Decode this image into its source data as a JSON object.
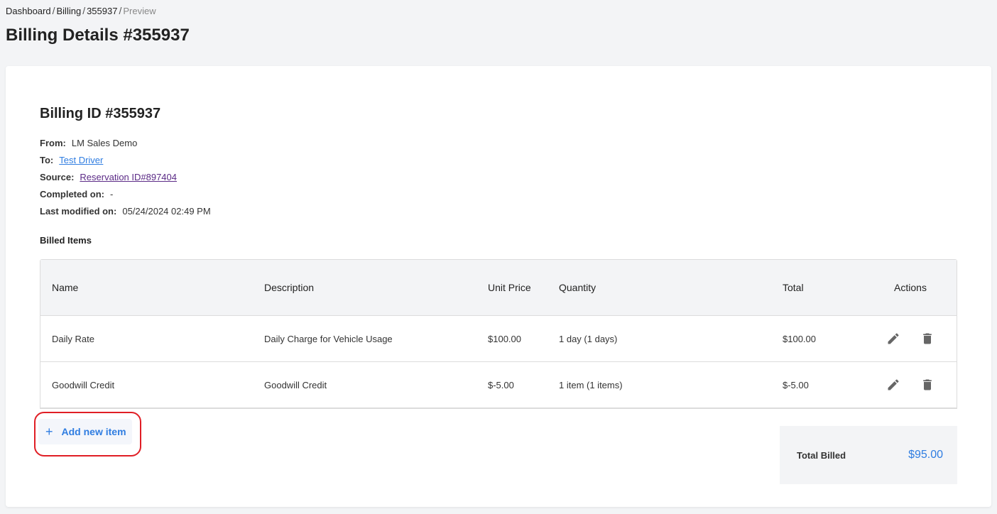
{
  "breadcrumb": {
    "items": [
      "Dashboard",
      "Billing",
      "355937",
      "Preview"
    ],
    "separator": "/"
  },
  "page": {
    "title": "Billing Details #355937"
  },
  "billing": {
    "id_title": "Billing ID #355937",
    "from_label": "From:",
    "from_value": "LM Sales Demo",
    "to_label": "To:",
    "to_value": "Test Driver",
    "source_label": "Source:",
    "source_value": "Reservation ID#897404",
    "completed_label": "Completed on:",
    "completed_value": "-",
    "modified_label": "Last modified on:",
    "modified_value": "05/24/2024 02:49 PM"
  },
  "items_section": {
    "title": "Billed Items"
  },
  "table": {
    "headers": [
      "Name",
      "Description",
      "Unit Price",
      "Quantity",
      "Total",
      "Actions"
    ],
    "rows": [
      {
        "name": "Daily Rate",
        "description": "Daily Charge for Vehicle Usage",
        "unit_price": "$100.00",
        "quantity": "1 day (1 days)",
        "total": "$100.00"
      },
      {
        "name": "Goodwill Credit",
        "description": "Goodwill Credit",
        "unit_price": "$-5.00",
        "quantity": "1 item (1 items)",
        "total": "$-5.00"
      }
    ]
  },
  "add_item": {
    "icon": "plus-icon",
    "label": "Add new item"
  },
  "summary": {
    "label": "Total Billed",
    "value": "$95.00"
  },
  "colors": {
    "accent": "#2f7de1",
    "source_link": "#5b2a86",
    "highlight": "#e01e25"
  },
  "icons": {
    "edit": "pencil-icon",
    "delete": "trash-icon"
  }
}
